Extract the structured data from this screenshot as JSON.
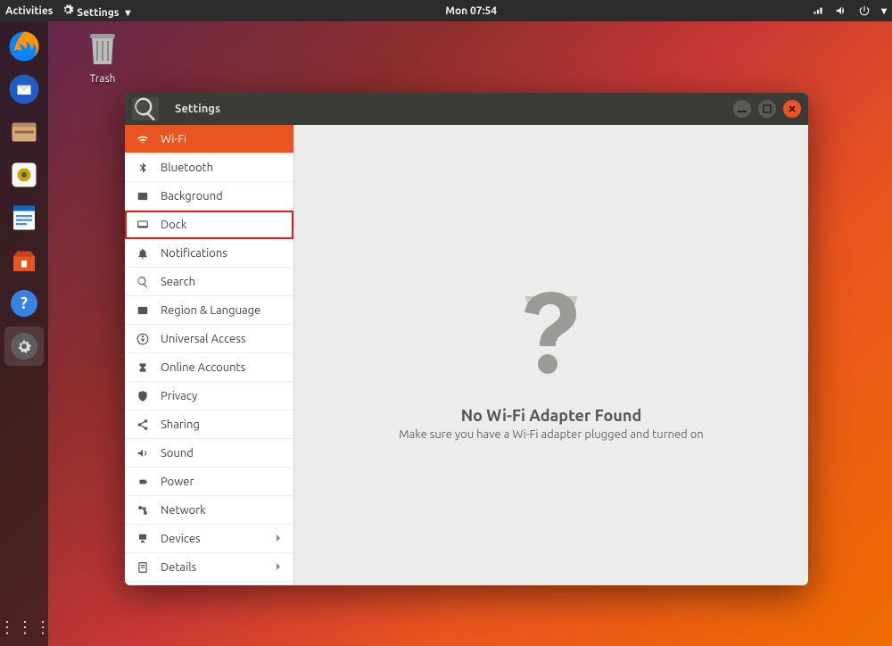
{
  "topbar": {
    "activities": "Activities",
    "app_menu": "Settings",
    "clock": "Mon 07:54"
  },
  "desktop": {
    "trash_label": "Trash"
  },
  "window": {
    "title": "Settings",
    "sidebar": [
      {
        "id": "wifi",
        "label": "Wi-Fi",
        "selected": true
      },
      {
        "id": "bluetooth",
        "label": "Bluetooth"
      },
      {
        "id": "background",
        "label": "Background"
      },
      {
        "id": "dock",
        "label": "Dock",
        "highlight": true
      },
      {
        "id": "notifications",
        "label": "Notifications"
      },
      {
        "id": "search",
        "label": "Search"
      },
      {
        "id": "region",
        "label": "Region & Language"
      },
      {
        "id": "ua",
        "label": "Universal Access"
      },
      {
        "id": "oa",
        "label": "Online Accounts"
      },
      {
        "id": "privacy",
        "label": "Privacy"
      },
      {
        "id": "sharing",
        "label": "Sharing"
      },
      {
        "id": "sound",
        "label": "Sound"
      },
      {
        "id": "power",
        "label": "Power"
      },
      {
        "id": "network",
        "label": "Network"
      },
      {
        "id": "devices",
        "label": "Devices",
        "chevron": true
      },
      {
        "id": "details",
        "label": "Details",
        "chevron": true
      }
    ],
    "content": {
      "heading": "No Wi-Fi Adapter Found",
      "subtext": "Make sure you have a Wi-Fi adapter plugged and turned on"
    }
  },
  "dock_apps": [
    "firefox",
    "thunderbird",
    "files",
    "rhythmbox",
    "writer",
    "software",
    "help",
    "settings"
  ]
}
